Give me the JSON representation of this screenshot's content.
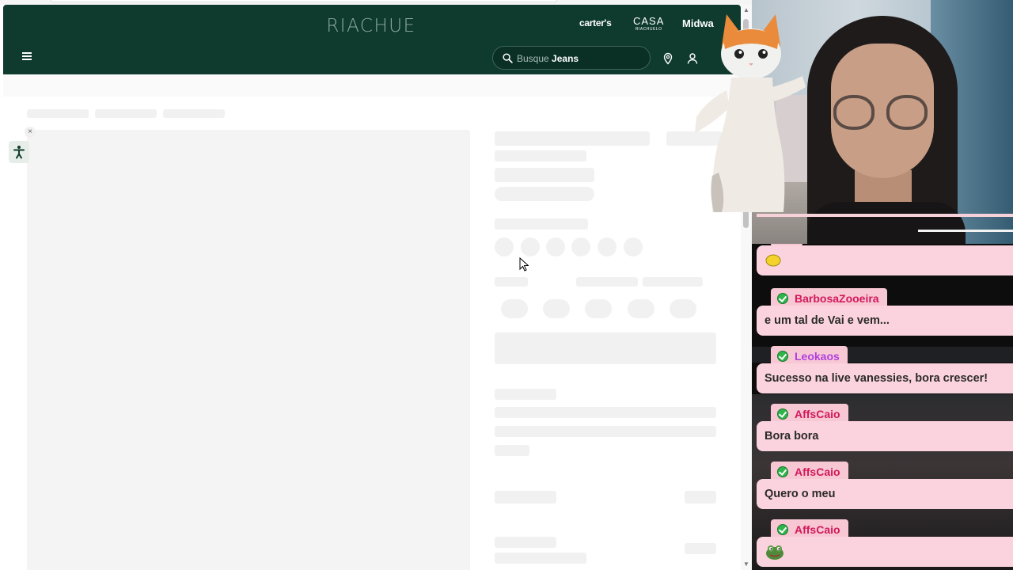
{
  "store": {
    "logo": "RIACHUE",
    "brands": {
      "carters": "carter's",
      "casa": "CASA",
      "casa_sub": "RIACHUELO",
      "midway": "Midwa"
    },
    "search": {
      "prefix": "Busque",
      "term": "Jeans"
    },
    "accessibility_close": "×"
  },
  "chat": {
    "messages": [
      {
        "user": "",
        "text": "",
        "emote": "yellow-emote"
      },
      {
        "user": "BarbosaZooeira",
        "text": "e um tal de Vai e vem..."
      },
      {
        "user": "Leokaos",
        "text": "Sucesso na live vanessies, bora crescer!"
      },
      {
        "user": "AffsCaio",
        "text": "Bora bora"
      },
      {
        "user": "AffsCaio",
        "text": "Quero o meu"
      },
      {
        "user": "AffsCaio",
        "text": "",
        "emote": "frog-emote"
      }
    ]
  },
  "colors": {
    "header_bg": "#0e3b2e",
    "chat_badge_bg": "#f7c8d4",
    "chat_username": "#d2185a",
    "chat_bubble_bg": "#fbd3de",
    "verified_green": "#2fb34a"
  }
}
